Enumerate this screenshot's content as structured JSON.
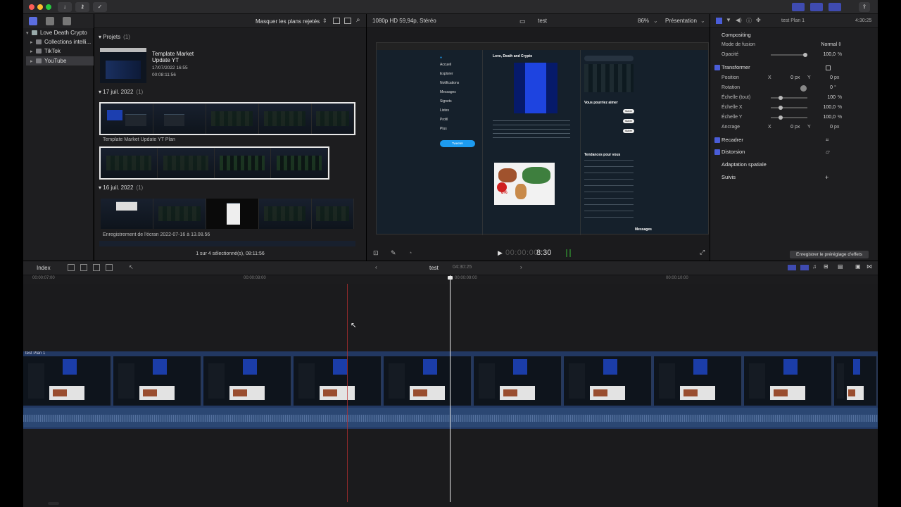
{
  "toolbar": {
    "colors": {
      "close": "#ff5f57",
      "minimize": "#febc2e",
      "zoom": "#28c840"
    },
    "buttons": [
      "download-icon",
      "key-icon",
      "checkmark-icon"
    ]
  },
  "libraries": {
    "items": [
      {
        "label": "Love Death Crypto",
        "level": 0,
        "expanded": true
      },
      {
        "label": "Collections intelli...",
        "level": 1
      },
      {
        "label": "TikTok",
        "level": 1
      },
      {
        "label": "YouTube",
        "level": 1,
        "selected": true
      }
    ]
  },
  "browser": {
    "filter_label": "Masquer les plans rejetés",
    "sections": [
      {
        "title": "Projets",
        "count": "(1)"
      },
      {
        "title": "17 juil. 2022",
        "count": "(1)"
      },
      {
        "title": "16 juil. 2022",
        "count": "(1)"
      }
    ],
    "project": {
      "title": "Template Market Update YT",
      "date": "17/07/2022 16:55",
      "duration": "00:08:11:56"
    },
    "clip_label_1": "Template Market Update YT Plan",
    "clip_label_2": "Enregistrement de l'écran 2022-07-16 à 13.08.56",
    "footer": "1 sur 4 sélectionné(s), 08:11:56"
  },
  "viewer": {
    "format": "1080p HD 59,94p, Stéréo",
    "title": "test",
    "zoom": "86%",
    "presentation": "Présentation",
    "timecode_dim": "00:00:00:",
    "timecode": "8:30"
  },
  "inspector": {
    "clip_name": "test Plan 1",
    "duration": "4:30:25",
    "compositing": "Compositing",
    "blend_mode_label": "Mode de fusion",
    "blend_mode": "Normal",
    "opacity_label": "Opacité",
    "opacity": "100,0",
    "percent": "%",
    "transform": "Transformer",
    "position_label": "Position",
    "x": "X",
    "y": "Y",
    "zero": "0",
    "px": "px",
    "rotation_label": "Rotation",
    "degree": "°",
    "scale_all_label": "Échelle (tout)",
    "scale_all": "100",
    "scale_x_label": "Échelle X",
    "scale_x": "100,0",
    "scale_y_label": "Échelle Y",
    "scale_y": "100,0",
    "anchor_label": "Ancrage",
    "crop": "Recadrer",
    "distortion": "Distorsion",
    "spatial": "Adaptation spatiale",
    "tracking": "Suivis",
    "save_preset": "Enregistrer le préréglage d'effets"
  },
  "timeline": {
    "index_label": "Index",
    "project_name": "test",
    "duration": "04:30:25",
    "ruler_ticks": [
      "00:00:07:00",
      "00:00:08:00",
      "00:00:09:00",
      "00:00:10:00"
    ],
    "clip_label": "test Plan 1",
    "accent": "#4a5dd8",
    "audio_color": "#2c4a78"
  },
  "video_frame": {
    "profile_name": "Love, Death and Crypto",
    "sidebar_items": [
      "Accueil",
      "Explorer",
      "Notifications",
      "Messages",
      "Signets",
      "Listes",
      "Profil",
      "Plus"
    ],
    "tweet_button": "Tweeter",
    "percent": "8%",
    "who_to_follow": "Vous pourriez aimer",
    "trends": "Tendances pour vous",
    "messages": "Messages",
    "follow_btn": "Suivre"
  }
}
